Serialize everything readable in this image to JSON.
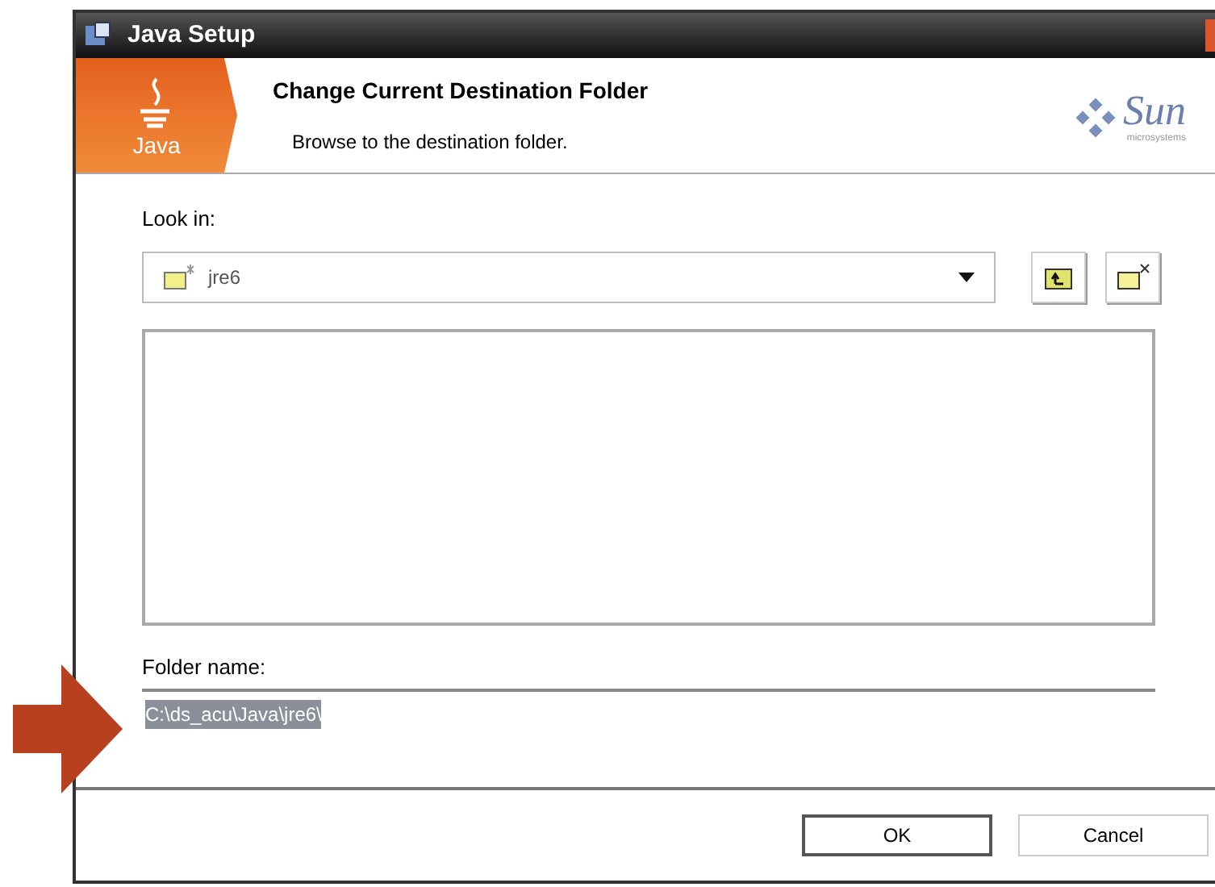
{
  "window": {
    "title": "Java Setup"
  },
  "header": {
    "logo_text": "Java",
    "title": "Change Current Destination Folder",
    "subtitle": "Browse to the destination folder.",
    "brand": "Sun",
    "brand_sub": "microsystems"
  },
  "look_in": {
    "label": "Look in:",
    "value": "jre6"
  },
  "folder_name": {
    "label": "Folder name:",
    "value": "C:\\ds_acu\\Java\\jre6\\",
    "selected": true
  },
  "buttons": [
    {
      "label": "OK",
      "default": true
    },
    {
      "label": "Cancel",
      "default": false
    }
  ]
}
